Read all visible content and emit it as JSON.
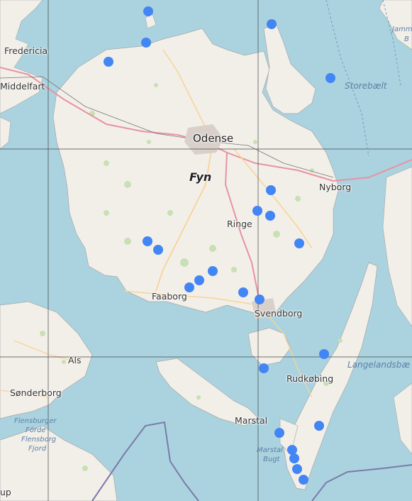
{
  "map": {
    "places": {
      "fredericia": "Fredericia",
      "middelfart": "Middelfart",
      "odense": "Odense",
      "fyn": "Fyn",
      "nyborg": "Nyborg",
      "ringe": "Ringe",
      "faaborg": "Faaborg",
      "svendborg": "Svendborg",
      "als": "Als",
      "sonderborg": "Sønderborg",
      "rudkobing": "Rudkøbing",
      "marstal": "Marstal",
      "up": "up"
    },
    "water": {
      "storebaelt": "Storebælt",
      "langelandsbaelt": "Langelandsbæ",
      "jammerland_1": "Jamm",
      "jammerland_2": "B",
      "flensburger_1": "Flensburger",
      "flensburger_2": "Förde",
      "flensborg_1": "Flensborg",
      "flensborg_2": "Fjord",
      "marstal_bugt_1": "Marstal",
      "marstal_bugt_2": "Bugt"
    },
    "marker_color": "#4285f4",
    "marker_count": 27
  }
}
